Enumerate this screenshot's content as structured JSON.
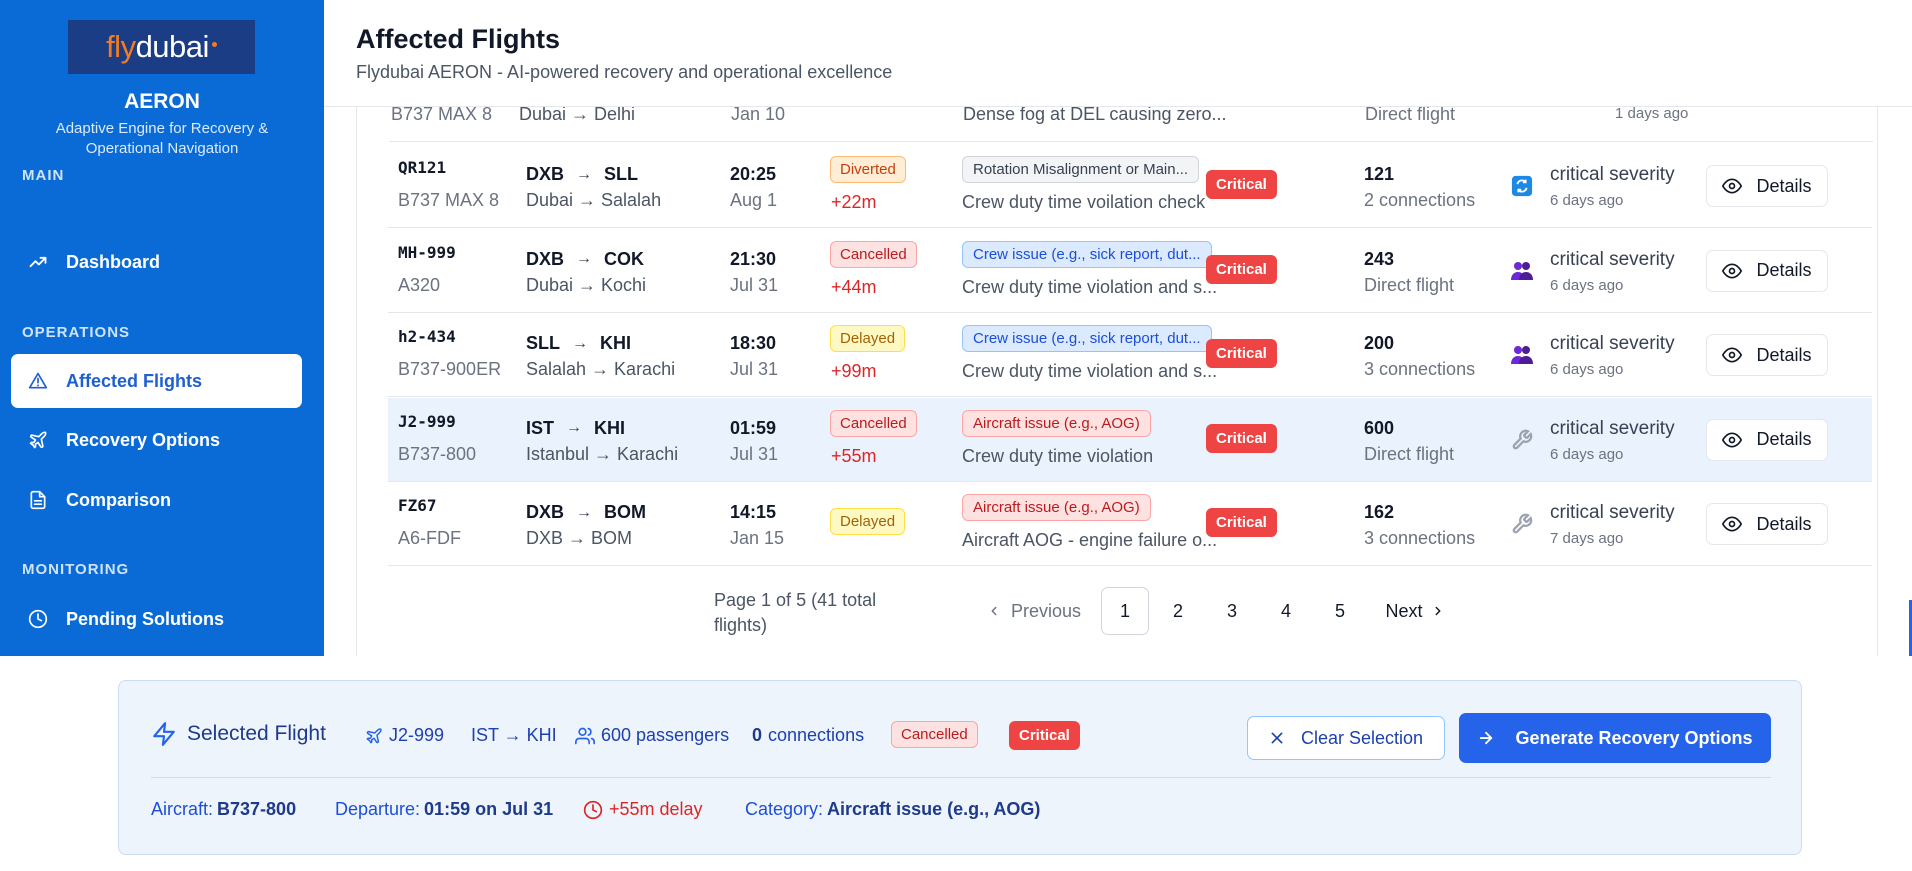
{
  "brand": {
    "logo_fly": "fly",
    "logo_dubai": "dubai",
    "app_name": "AERON",
    "tagline": "Adaptive Engine for Recovery & Operational Navigation"
  },
  "sidebar": {
    "sections": [
      {
        "title": "MAIN",
        "items": [
          {
            "label": "Dashboard",
            "icon": "trending-up-icon",
            "active": false
          }
        ]
      },
      {
        "title": "OPERATIONS",
        "items": [
          {
            "label": "Affected Flights",
            "icon": "alert-triangle-icon",
            "active": true
          },
          {
            "label": "Recovery Options",
            "icon": "plane-icon",
            "active": false
          },
          {
            "label": "Comparison",
            "icon": "document-icon",
            "active": false
          }
        ]
      },
      {
        "title": "MONITORING",
        "items": [
          {
            "label": "Pending Solutions",
            "icon": "clock-icon",
            "active": false
          }
        ]
      }
    ]
  },
  "header": {
    "title": "Affected Flights",
    "subtitle": "Flydubai AERON - AI-powered recovery and operational excellence"
  },
  "table": {
    "partial_row": {
      "aircraft": "B737 MAX 8",
      "route": "Dubai → Delhi",
      "date": "Jan 10",
      "description": "Dense fog at DEL causing zero...",
      "connections": "Direct flight",
      "ago": "1 days ago"
    },
    "rows": [
      {
        "flight": "QR121",
        "aircraft": "B737 MAX 8",
        "origin": "DXB",
        "dest": "SLL",
        "route": "Dubai → Salalah",
        "time": "20:25",
        "date": "Aug 1",
        "status": "Diverted",
        "status_class": "diverted",
        "delay": "+22m",
        "category": "Rotation Misalignment or Main...",
        "cat_class": "gray",
        "description": "Crew duty time voilation check",
        "severity": "Critical",
        "passengers": "121",
        "connections": "2 connections",
        "type_icon": "rotation-icon",
        "sev_text": "critical severity",
        "ago": "6 days ago",
        "details": "Details",
        "selected": false
      },
      {
        "flight": "MH-999",
        "aircraft": "A320",
        "origin": "DXB",
        "dest": "COK",
        "route": "Dubai → Kochi",
        "time": "21:30",
        "date": "Jul 31",
        "status": "Cancelled",
        "status_class": "cancelled",
        "delay": "+44m",
        "category": "Crew issue (e.g., sick report, dut...",
        "cat_class": "blue",
        "description": "Crew duty time violation and s...",
        "severity": "Critical",
        "passengers": "243",
        "connections": "Direct flight",
        "type_icon": "crew-icon",
        "sev_text": "critical severity",
        "ago": "6 days ago",
        "details": "Details",
        "selected": false
      },
      {
        "flight": "h2-434",
        "aircraft": "B737-900ER",
        "origin": "SLL",
        "dest": "KHI",
        "route": "Salalah → Karachi",
        "time": "18:30",
        "date": "Jul 31",
        "status": "Delayed",
        "status_class": "delayed",
        "delay": "+99m",
        "category": "Crew issue (e.g., sick report, dut...",
        "cat_class": "blue",
        "description": "Crew duty time violation and s...",
        "severity": "Critical",
        "passengers": "200",
        "connections": "3 connections",
        "type_icon": "crew-icon",
        "sev_text": "critical severity",
        "ago": "6 days ago",
        "details": "Details",
        "selected": false
      },
      {
        "flight": "J2-999",
        "aircraft": "B737-800",
        "origin": "IST",
        "dest": "KHI",
        "route": "Istanbul → Karachi",
        "time": "01:59",
        "date": "Jul 31",
        "status": "Cancelled",
        "status_class": "cancelled",
        "delay": "+55m",
        "category": "Aircraft issue (e.g., AOG)",
        "cat_class": "red",
        "description": "Crew duty time violation",
        "severity": "Critical",
        "passengers": "600",
        "connections": "Direct flight",
        "type_icon": "wrench-icon",
        "sev_text": "critical severity",
        "ago": "6 days ago",
        "details": "Details",
        "selected": true
      },
      {
        "flight": "FZ67",
        "aircraft": "A6-FDF",
        "origin": "DXB",
        "dest": "BOM",
        "route": "DXB → BOM",
        "time": "14:15",
        "date": "Jan 15",
        "status": "Delayed",
        "status_class": "delayed",
        "delay": "",
        "category": "Aircraft issue (e.g., AOG)",
        "cat_class": "red",
        "description": "Aircraft AOG - engine failure o...",
        "severity": "Critical",
        "passengers": "162",
        "connections": "3 connections",
        "type_icon": "wrench-icon",
        "sev_text": "critical severity",
        "ago": "7 days ago",
        "details": "Details",
        "selected": false
      }
    ]
  },
  "pagination": {
    "info": "Page 1 of 5 (41 total flights)",
    "previous": "Previous",
    "next": "Next",
    "pages": [
      "1",
      "2",
      "3",
      "4",
      "5"
    ],
    "current": "1"
  },
  "selected_flight": {
    "title": "Selected Flight",
    "flight": "J2-999",
    "route": "IST → KHI",
    "passengers": "600 passengers",
    "connections_count": "0",
    "connections_label": "connections",
    "status": "Cancelled",
    "severity": "Critical",
    "clear_label": "Clear Selection",
    "generate_label": "Generate Recovery Options",
    "aircraft_label": "Aircraft:",
    "aircraft_value": "B737-800",
    "departure_label": "Departure:",
    "departure_value": "01:59 on Jul 31",
    "delay": "+55m delay",
    "category_label": "Category:",
    "category_value": "Aircraft issue (e.g., AOG)"
  },
  "colors": {
    "sidebar_bg": "#0a6bd6",
    "primary": "#2563eb",
    "critical": "#ef4444",
    "selected_row": "#eaf2fd"
  }
}
